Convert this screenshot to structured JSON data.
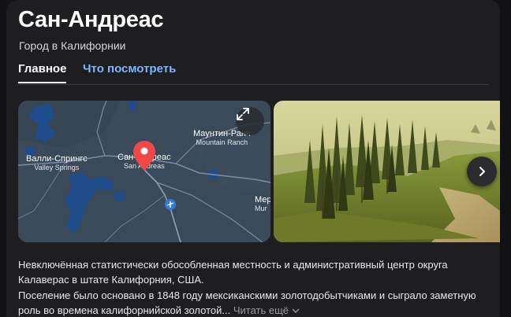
{
  "header": {
    "title": "Сан-Андреас",
    "subtitle": "Город в Калифорнии"
  },
  "tabs": [
    {
      "label": "Главное",
      "active": true
    },
    {
      "label": "Что посмотреть",
      "active": false
    }
  ],
  "map": {
    "labels": {
      "san_andreas": "Сан-Андреас",
      "san_andreas_en": "San Andreas",
      "valley_springs": "Валли-Спрингс",
      "valley_springs_en": "Valley Springs",
      "mountain_ranch": "Маунтин-Ранч",
      "mountain_ranch_en": "Mountain Ranch",
      "mer": "Мер",
      "mur": "Mur"
    },
    "colors": {
      "land": "#3b4a58",
      "water": "#1f4d8c",
      "road": "#7c8ba0",
      "marker": "#f04848"
    }
  },
  "description": {
    "paragraph1": "Невключённая статистически обособленная местность и административный центр округа Калаверас в штате Калифорния, США.",
    "paragraph2": "Поселение было основано в 1848 году мексиканскими золотодобытчиками и сыграло заметную роль во времена калифорнийской золотой...",
    "read_more": "Читать ещё"
  },
  "icons": {
    "expand": "expand-icon",
    "next": "chevron-right-icon",
    "marker": "map-pin-icon",
    "airport": "airport-icon",
    "read_more_chevron": "chevron-down-icon"
  }
}
